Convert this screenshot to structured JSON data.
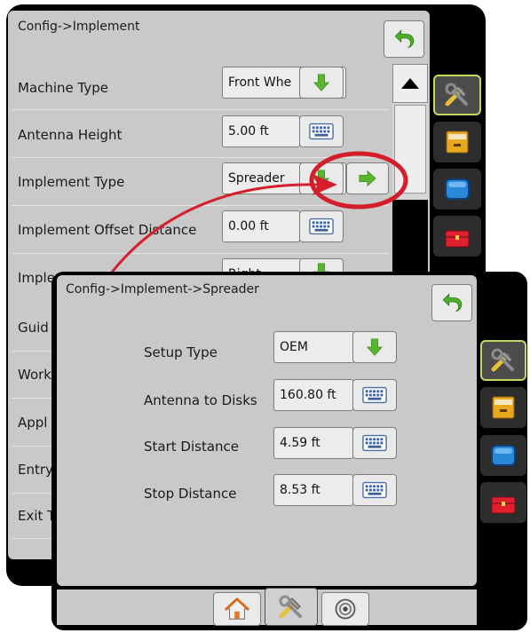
{
  "back_screen": {
    "title": "Config->Implement",
    "rows": [
      {
        "label": "Machine Type",
        "value": "Front Whe",
        "control": "dropdown"
      },
      {
        "label": "Antenna Height",
        "value": "5.00 ft",
        "control": "keyboard"
      },
      {
        "label": "Implement Type",
        "value": "Spreader",
        "control": "dropdown"
      },
      {
        "label": "Implement Offset Distance",
        "value": "0.00 ft",
        "control": "keyboard"
      },
      {
        "label": "Implement Offset Direction",
        "value": "Right",
        "control": "dropdown"
      }
    ],
    "partial_rows": [
      "Guid",
      "Work",
      "Appl",
      "Entry",
      "Exit T"
    ]
  },
  "front_screen": {
    "title": "Config->Implement->Spreader",
    "rows": [
      {
        "label": "Setup Type",
        "value": "OEM",
        "control": "dropdown"
      },
      {
        "label": "Antenna to Disks",
        "value": "160.80 ft",
        "control": "keyboard"
      },
      {
        "label": "Start Distance",
        "value": "4.59 ft",
        "control": "keyboard"
      },
      {
        "label": "Stop Distance",
        "value": "8.53 ft",
        "control": "keyboard"
      }
    ]
  },
  "icons": {
    "back": "back-arrow-icon",
    "dropdown": "green-down-arrow-icon",
    "keyboard": "keyboard-icon",
    "next": "green-right-arrow-icon",
    "tabs": [
      "tools-icon",
      "file-drawer-icon",
      "display-screen-icon",
      "toolbox-icon"
    ],
    "bottom": [
      "home-icon",
      "tools-icon",
      "gauge-icon"
    ]
  },
  "colors": {
    "accent_green": "#5ab52e",
    "highlight_red": "#d41f2a",
    "panel_gray": "#c9c9c9",
    "active_outline": "#c6d85a"
  }
}
